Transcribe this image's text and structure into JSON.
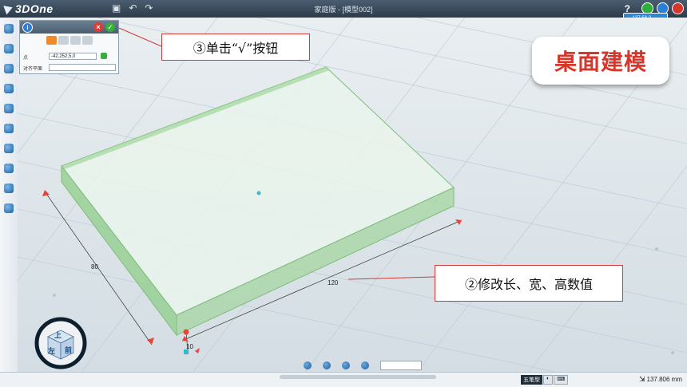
{
  "app": {
    "logo_text": "3DOne",
    "window_title": "家庭版 - [模型002]",
    "help_label": "?",
    "cloud_badge": "137.58.0"
  },
  "panel": {
    "info_label": "i",
    "close_label": "×",
    "ok_label": "✓",
    "point_label": "点",
    "point_value": "-42,252,5,0",
    "align_label": "对齐平面",
    "align_value": ""
  },
  "annotations": {
    "step3": "③单击“√”按钮",
    "step2": "②修改长、宽、高数值",
    "badge": "桌面建模"
  },
  "dimensions": {
    "length": "120",
    "width": "80",
    "height": "10"
  },
  "navcube": {
    "top": "上",
    "front": "前",
    "left": "左"
  },
  "status": {
    "tab1": "五笔型",
    "zoom": "137.806 mm"
  },
  "colors": {
    "accent": "#d8352b",
    "box_fill": "#8fd08a",
    "titlebar": "#3b4b5b"
  }
}
